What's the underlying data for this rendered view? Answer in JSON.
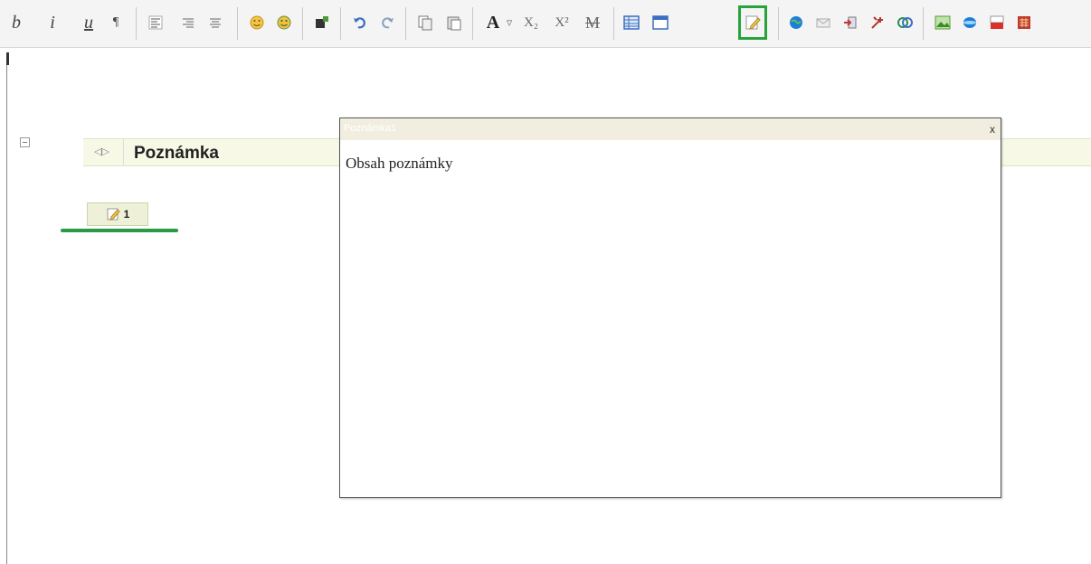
{
  "toolbar": {
    "text_buttons": {
      "bold": "b",
      "italic": "i",
      "underline": "u",
      "paragraph": "¶",
      "font": "A",
      "font_dropdown": "▿",
      "subscript": "X₂",
      "superscript": "X²",
      "strikethrough": "M"
    },
    "icons": [
      "align-left-icon",
      "align-right-icon",
      "align-center-icon",
      "smiley-icon",
      "smiley-green-icon",
      "special-char-icon",
      "undo-icon",
      "redo-icon",
      "copy-icon",
      "paste-icon",
      "table-icon",
      "table-window-icon",
      "note-icon",
      "globe-icon",
      "envelope-icon",
      "import-icon",
      "tools-icon",
      "link-icon",
      "image-icon",
      "media-icon",
      "youtube-icon",
      "calculator-icon"
    ],
    "active_button": "note-icon"
  },
  "note": {
    "title": "Poznámka",
    "ref_count": "1"
  },
  "popup": {
    "title": "Poznámka1",
    "close": "x",
    "content": "Obsah poznámky"
  },
  "colors": {
    "highlight_green": "#27a33c",
    "header_bg": "#f7f9e6"
  }
}
